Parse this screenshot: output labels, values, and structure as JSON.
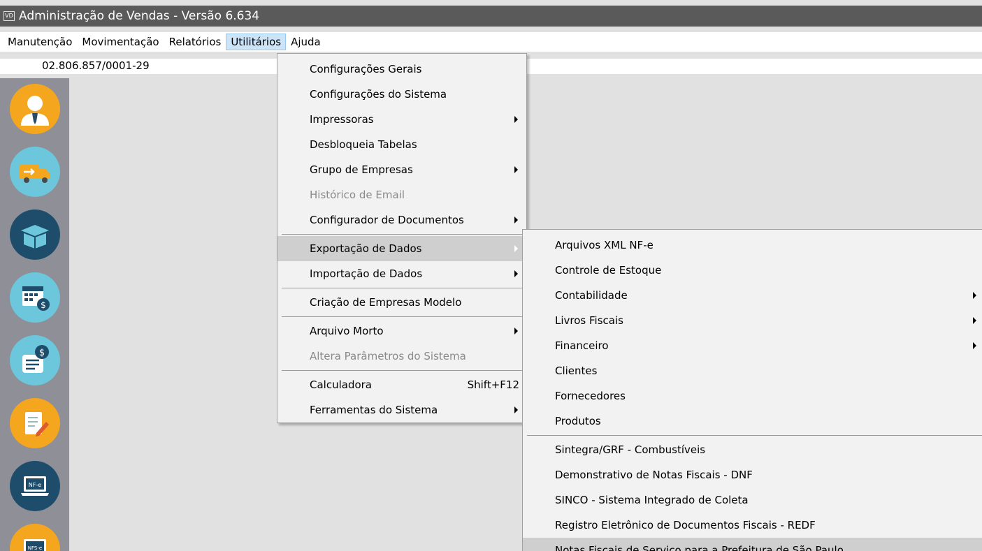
{
  "window": {
    "icon_text": "VD",
    "title": "Administração de Vendas - Versão 6.634"
  },
  "menubar": [
    "Manutenção",
    "Movimentação",
    "Relatórios",
    "Utilitários",
    "Ajuda"
  ],
  "company": {
    "cnpj": "02.806.857/0001-29"
  },
  "sidebar_icons": [
    {
      "name": "user-icon",
      "color": "#f4a61f"
    },
    {
      "name": "truck-icon",
      "color": "#6cc6dc"
    },
    {
      "name": "box-icon",
      "color": "#1d4d6b"
    },
    {
      "name": "calendar-money-icon",
      "color": "#6cc6dc"
    },
    {
      "name": "invoice-money-icon",
      "color": "#6cc6dc"
    },
    {
      "name": "document-edit-icon",
      "color": "#f4a61f"
    },
    {
      "name": "nfe-laptop-icon",
      "color": "#1d4d6b"
    },
    {
      "name": "nfse-icon",
      "color": "#f4a61f"
    }
  ],
  "util_menu": {
    "items": [
      {
        "label": "Configurações Gerais"
      },
      {
        "label": "Configurações do Sistema"
      },
      {
        "label": "Impressoras",
        "submenu": true
      },
      {
        "label": "Desbloqueia Tabelas"
      },
      {
        "label": "Grupo de Empresas",
        "submenu": true
      },
      {
        "label": "Histórico de Email",
        "disabled": true
      },
      {
        "label": "Configurador de Documentos",
        "submenu": true,
        "sep_after": true
      },
      {
        "label": "Exportação de Dados",
        "submenu": true,
        "highlighted": true
      },
      {
        "label": "Importação de Dados",
        "submenu": true,
        "sep_after": true
      },
      {
        "label": "Criação de Empresas Modelo",
        "sep_after": true
      },
      {
        "label": "Arquivo Morto",
        "submenu": true
      },
      {
        "label": "Altera Parâmetros do Sistema",
        "disabled": true,
        "sep_after": true
      },
      {
        "label": "Calculadora",
        "shortcut": "Shift+F12"
      },
      {
        "label": "Ferramentas do Sistema",
        "submenu": true
      }
    ]
  },
  "export_menu": {
    "items": [
      {
        "label": "Arquivos XML NF-e"
      },
      {
        "label": "Controle de Estoque"
      },
      {
        "label": "Contabilidade",
        "submenu": true
      },
      {
        "label": "Livros Fiscais",
        "submenu": true
      },
      {
        "label": "Financeiro",
        "submenu": true
      },
      {
        "label": "Clientes"
      },
      {
        "label": "Fornecedores"
      },
      {
        "label": "Produtos",
        "sep_after": true
      },
      {
        "label": "Sintegra/GRF - Combustíveis"
      },
      {
        "label": "Demonstrativo de Notas Fiscais - DNF"
      },
      {
        "label": "SINCO - Sistema Integrado de Coleta"
      },
      {
        "label": "Registro Eletrônico de Documentos Fiscais - REDF"
      },
      {
        "label": "Notas Fiscais de Serviço para a Prefeitura de São Paulo",
        "highlighted": true
      }
    ]
  }
}
